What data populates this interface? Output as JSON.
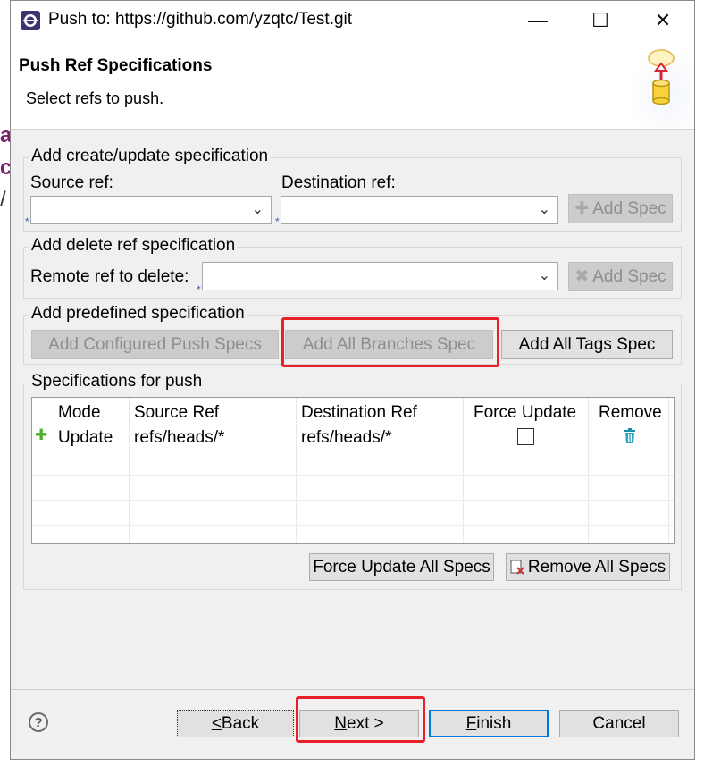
{
  "window": {
    "title": "Push to: https://github.com/yzqtc/Test.git",
    "controls": {
      "minimize": "—",
      "maximize": "☐",
      "close": "✕"
    }
  },
  "header": {
    "title": "Push Ref Specifications",
    "subtitle": "Select refs to push."
  },
  "create_update": {
    "group_label": "Add create/update specification",
    "source_label": "Source ref:",
    "destination_label": "Destination ref:",
    "source_value": "",
    "destination_value": "",
    "add_spec_label": "Add Spec"
  },
  "delete_ref": {
    "group_label": "Add delete ref specification",
    "remote_label": "Remote ref to delete:",
    "remote_value": "",
    "add_spec_label": "Add Spec"
  },
  "predefined": {
    "group_label": "Add predefined specification",
    "configured_label": "Add Configured Push Specs",
    "all_branches_label": "Add All Branches Spec",
    "all_tags_label": "Add All Tags Spec"
  },
  "specs": {
    "group_label": "Specifications for push",
    "columns": [
      "Mode",
      "Source Ref",
      "Destination Ref",
      "Force Update",
      "Remove"
    ],
    "rows": [
      {
        "mode": "Update",
        "source": "refs/heads/*",
        "destination": "refs/heads/*",
        "force_update": false
      }
    ],
    "force_all_label": "Force Update All Specs",
    "remove_all_label": "Remove All Specs"
  },
  "footer": {
    "help": "?",
    "back_label": " Back",
    "back_mnemonic": "<",
    "next_mnemonic": "N",
    "next_label": "ext >",
    "finish_mnemonic": "F",
    "finish_label": "inish",
    "cancel_label": "Cancel"
  },
  "background_letters": [
    "a",
    "c",
    "/"
  ],
  "colors": {
    "highlight": "#e8202a",
    "primary_border": "#0078d7",
    "add_icon": "#4caf2f",
    "trash_icon": "#1a8fa8"
  }
}
